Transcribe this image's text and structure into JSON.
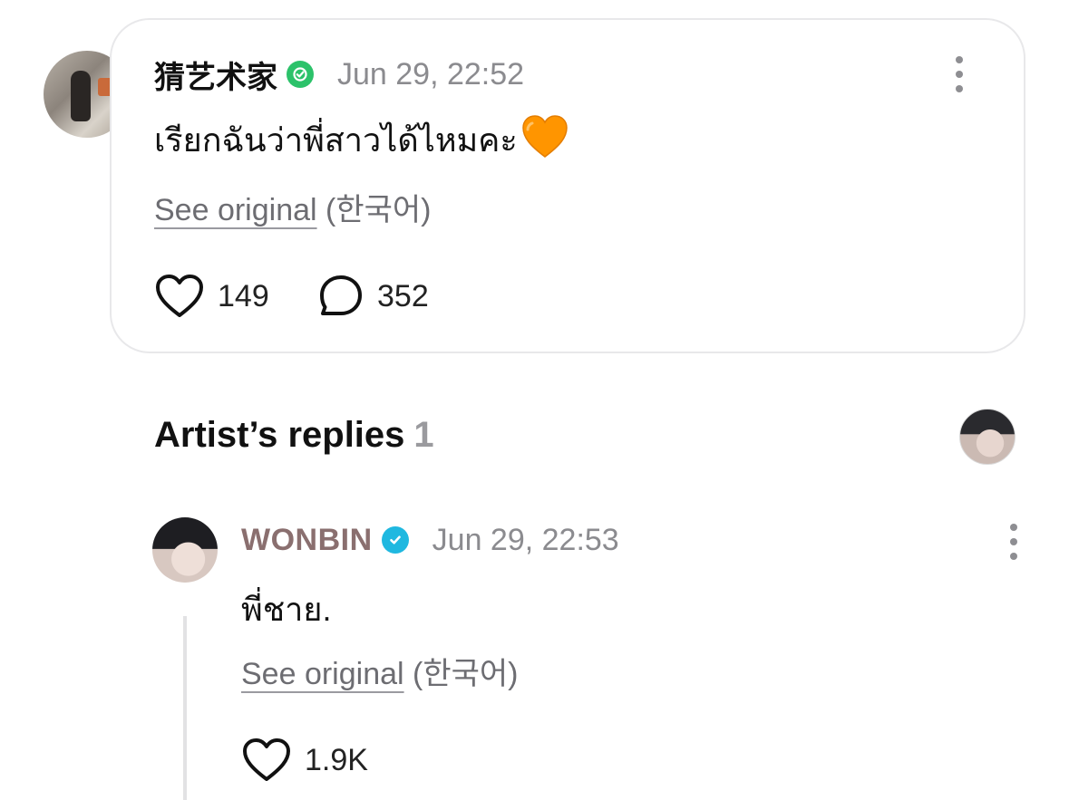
{
  "fan_post": {
    "author": "猜艺术家",
    "timestamp": "Jun 29, 22:52",
    "body": "เรียกฉันว่าพี่สาวได้ไหมคะ",
    "emoji": "orange-heart-emoji",
    "see_original": "See original",
    "language": "(한국어)",
    "likes": "149",
    "comments": "352",
    "verified_color": "#2cc26a"
  },
  "artist_replies": {
    "title": "Artist’s replies",
    "count": "1",
    "reply": {
      "author": "WONBIN",
      "timestamp": "Jun 29, 22:53",
      "body": "พี่ชาย.",
      "see_original": "See original",
      "language": "(한국어)",
      "likes": "1.9K",
      "author_color": "#8a6f6f",
      "verified_color": "#1fb8e0"
    }
  },
  "icons": {
    "like": "heart-outline-icon",
    "comment": "chat-bubble-icon",
    "more": "more-vertical-icon",
    "verified": "verified-badge-icon"
  }
}
